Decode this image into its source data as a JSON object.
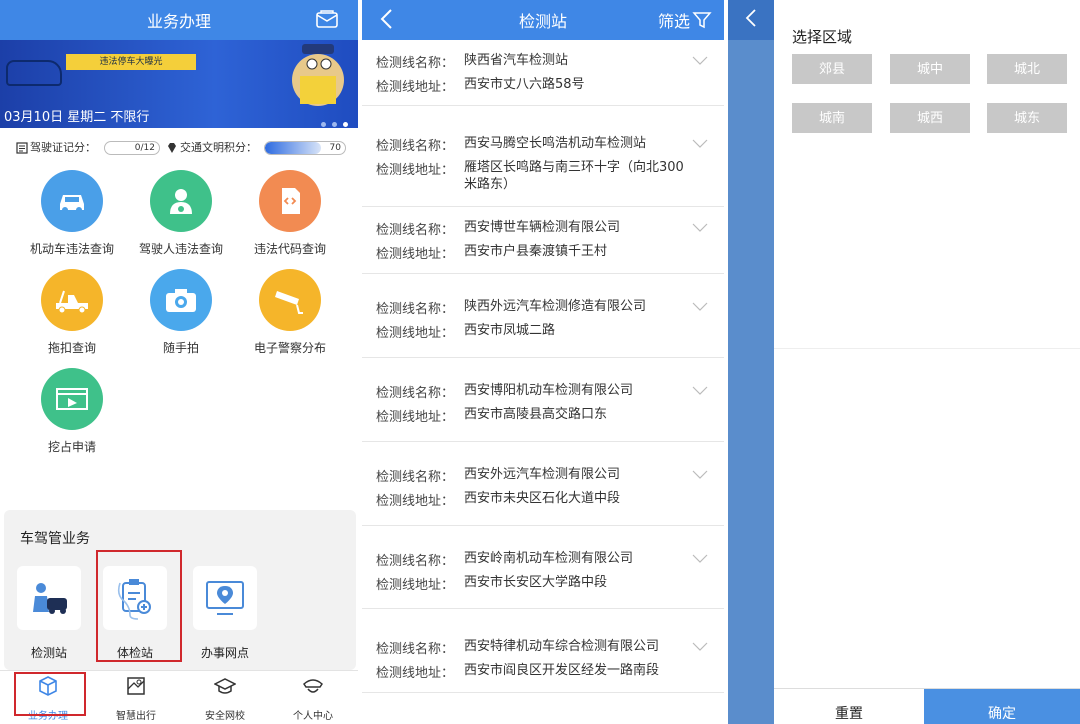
{
  "business": {
    "header": {
      "title": "业务办理"
    },
    "banner": {
      "tag": "违法停车大曝光",
      "date": "03月10日 星期二 不限行"
    },
    "scores": {
      "license_label": "驾驶证记分：",
      "license_value": "0/12",
      "civility_label": "交通文明积分：",
      "civility_value": "70",
      "civility_fraction": 0.7
    },
    "services": [
      {
        "label": "机动车违法查询",
        "icon": "car-icon",
        "color": "#4a9fe8"
      },
      {
        "label": "驾驶人违法查询",
        "icon": "driver-icon",
        "color": "#3fc18a"
      },
      {
        "label": "违法代码查询",
        "icon": "code-icon",
        "color": "#f28b52"
      },
      {
        "label": "拖扣查询",
        "icon": "tow-truck-icon",
        "color": "#f5b52a"
      },
      {
        "label": "随手拍",
        "icon": "camera-icon",
        "color": "#4aa8ec"
      },
      {
        "label": "电子警察分布",
        "icon": "surveillance-camera-icon",
        "color": "#f5b52a"
      },
      {
        "label": "挖占申请",
        "icon": "excavation-icon",
        "color": "#3fc18a"
      }
    ],
    "vehicle_business": {
      "title": "车驾管业务",
      "items": [
        {
          "label": "检测站",
          "icon": "inspection-station-icon"
        },
        {
          "label": "体检站",
          "icon": "medical-exam-icon"
        },
        {
          "label": "办事网点",
          "icon": "location-pin-icon"
        }
      ]
    },
    "tabbar": [
      {
        "label": "业务办理",
        "icon": "cube-icon",
        "active": true
      },
      {
        "label": "智慧出行",
        "icon": "map-icon",
        "active": false
      },
      {
        "label": "安全网校",
        "icon": "graduation-cap-icon",
        "active": false
      },
      {
        "label": "个人中心",
        "icon": "officer-cap-icon",
        "active": false
      }
    ]
  },
  "stations": {
    "header": {
      "title": "检测站",
      "filter": "筛选"
    },
    "name_label": "检测线名称：",
    "address_label": "检测线地址：",
    "list": [
      {
        "name": "陕西省汽车检测站",
        "address": "西安市丈八六路58号"
      },
      {
        "name": "西安马腾空长鸣浩机动车检测站",
        "address": "雁塔区长鸣路与南三环十字（向北300米路东）"
      },
      {
        "name": "西安博世车辆检测有限公司",
        "address": "西安市户县秦渡镇千王村"
      },
      {
        "name": "陕西外远汽车检测修造有限公司",
        "address": "西安市凤城二路"
      },
      {
        "name": "西安博阳机动车检测有限公司",
        "address": "西安市高陵县高交路口东"
      },
      {
        "name": "西安外远汽车检测有限公司",
        "address": "西安市未央区石化大道中段"
      },
      {
        "name": "西安岭南机动车检测有限公司",
        "address": "西安市长安区大学路中段"
      },
      {
        "name": "西安特律机动车综合检测有限公司",
        "address": "西安市阎良区开发区经发一路南段"
      }
    ]
  },
  "region_filter": {
    "title": "选择区域",
    "regions": [
      "郊县",
      "城中",
      "城北",
      "城南",
      "城西",
      "城东"
    ],
    "reset": "重置",
    "confirm": "确定"
  }
}
